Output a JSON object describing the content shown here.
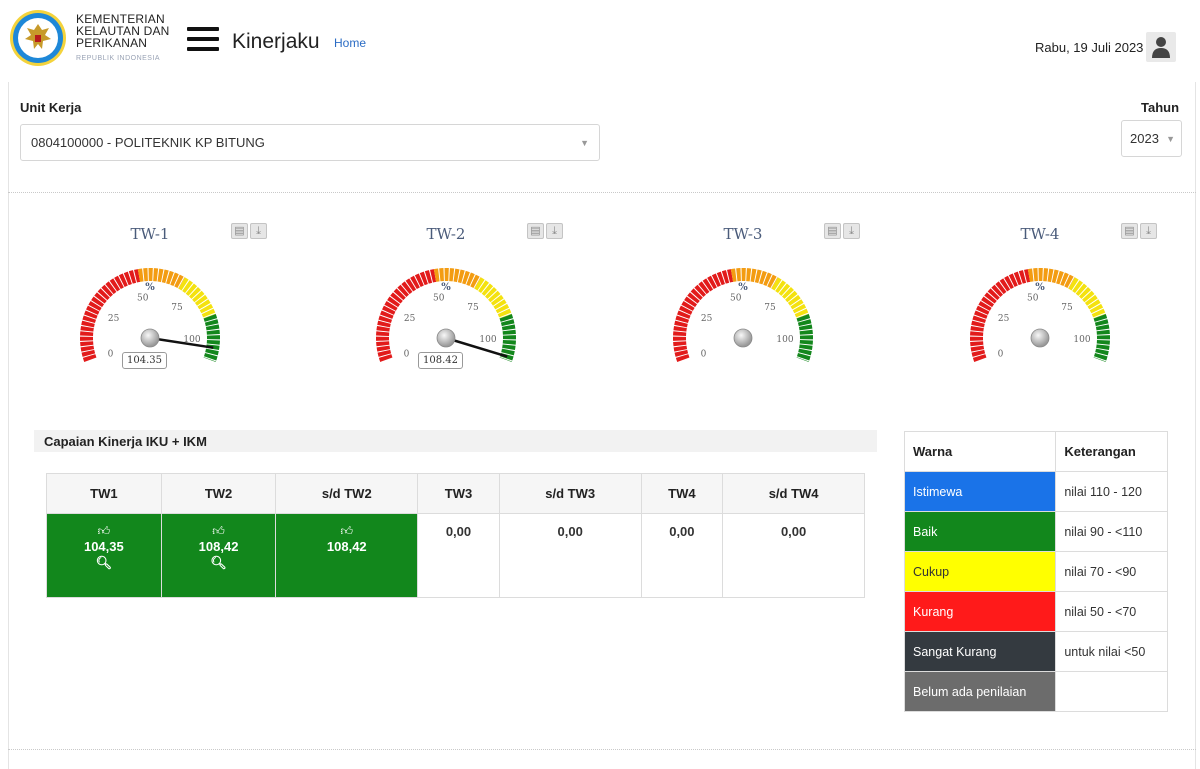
{
  "header": {
    "ministry_line1": "KEMENTERIAN",
    "ministry_line2": "KELAUTAN DAN",
    "ministry_line3": "PERIKANAN",
    "ministry_sub": "REPUBLIK INDONESIA",
    "app_title": "Kinerjaku",
    "home_link": "Home",
    "date": "Rabu, 19 Juli 2023",
    "menu_icon": "hamburger-icon",
    "user_icon": "user-icon"
  },
  "filters": {
    "unit_label": "Unit Kerja",
    "unit_value": "0804100000 - POLITEKNIK KP BITUNG",
    "year_label": "Tahun",
    "year_value": "2023"
  },
  "gauges": [
    {
      "title": "TW-1",
      "value": 104.35,
      "value_label": "104.35"
    },
    {
      "title": "TW-2",
      "value": 108.42,
      "value_label": "108.42"
    },
    {
      "title": "TW-3",
      "value": null,
      "value_label": ""
    },
    {
      "title": "TW-4",
      "value": null,
      "value_label": ""
    }
  ],
  "gauge_scale": {
    "ticks": [
      "0",
      "25",
      "50",
      "75",
      "100"
    ],
    "unit": "%",
    "max": 110,
    "bands": [
      {
        "from": 0,
        "to": 50,
        "color": "#e21b1b"
      },
      {
        "from": 50,
        "to": 70,
        "color": "#f39c12"
      },
      {
        "from": 70,
        "to": 90,
        "color": "#f4e20f"
      },
      {
        "from": 90,
        "to": 110,
        "color": "#13871c"
      }
    ]
  },
  "capaian": {
    "title": "Capaian Kinerja IKU + IKM",
    "headers": [
      "TW1",
      "TW2",
      "s/d TW2",
      "TW3",
      "s/d TW3",
      "TW4",
      "s/d TW4"
    ],
    "cells": [
      "104,35",
      "108,42",
      "108,42",
      "0,00",
      "0,00",
      "0,00",
      "0,00"
    ],
    "green_color": "#12871c",
    "icons": {
      "thumb": "thumbs-up-icon",
      "search": "magnifier-icon"
    }
  },
  "legend": {
    "headers": [
      "Warna",
      "Keterangan"
    ],
    "rows": [
      {
        "label": "Istimewa",
        "desc": "nilai 110 - 120",
        "color": "#1a73e8"
      },
      {
        "label": "Baik",
        "desc": "nilai 90 - <110",
        "color": "#12871c"
      },
      {
        "label": "Cukup",
        "desc": "nilai 70 - <90",
        "color": "#ffff00"
      },
      {
        "label": "Kurang",
        "desc": "nilai 50 - <70",
        "color": "#ff1a1a"
      },
      {
        "label": "Sangat Kurang",
        "desc": "untuk nilai <50",
        "color": "#343a40"
      },
      {
        "label": "Belum ada penilaian",
        "desc": "",
        "color": "#6c6c6c"
      }
    ]
  }
}
